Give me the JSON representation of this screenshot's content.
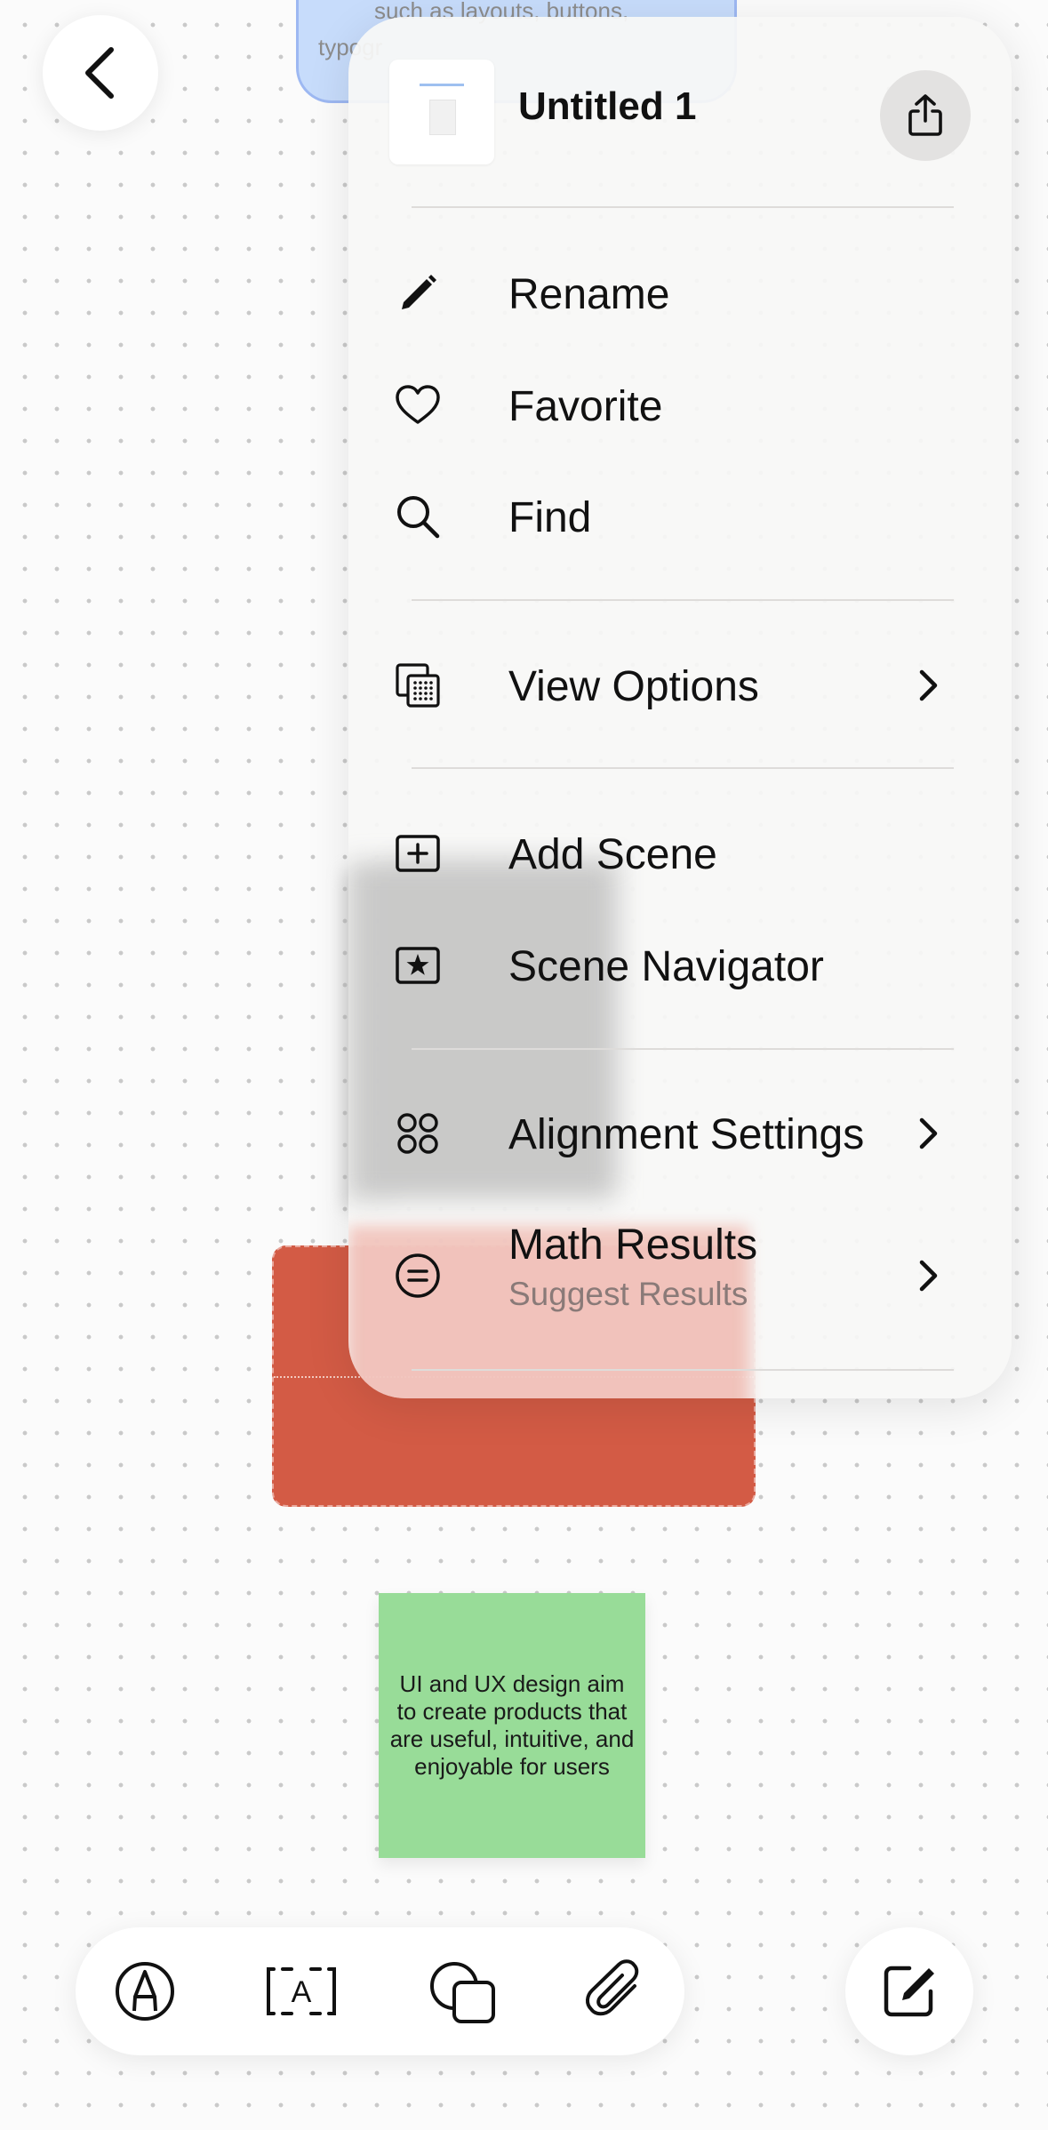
{
  "canvas": {
    "blue_note": {
      "line1": "such as layouts, buttons,",
      "line2": "typogr"
    },
    "green_note": {
      "text": "UI and UX design aim to create products that are useful, intuitive, and enjoyable for users"
    },
    "colors": {
      "blue_note": "#c7dcfb",
      "red_rect": "#d35b45",
      "green_note": "#98dc98"
    }
  },
  "header": {
    "back_icon": "chevron-left-icon"
  },
  "menu": {
    "title": "Untitled 1",
    "share_icon": "share-icon",
    "items": [
      {
        "label": "Rename",
        "icon": "pencil-icon"
      },
      {
        "label": "Favorite",
        "icon": "heart-icon"
      },
      {
        "label": "Find",
        "icon": "magnifier-icon"
      },
      {
        "label": "View Options",
        "icon": "view-options-icon",
        "has_submenu": true
      },
      {
        "label": "Add Scene",
        "icon": "add-scene-icon"
      },
      {
        "label": "Scene Navigator",
        "icon": "scene-navigator-icon"
      },
      {
        "label": "Alignment Settings",
        "icon": "alignment-icon",
        "has_submenu": true
      },
      {
        "label": "Math Results",
        "sublabel": "Suggest Results",
        "icon": "equals-circle-icon",
        "has_submenu": true
      }
    ]
  },
  "toolbar": {
    "tools": [
      {
        "icon": "pen-tool-icon"
      },
      {
        "icon": "text-box-icon",
        "glyph": "A"
      },
      {
        "icon": "shapes-icon"
      },
      {
        "icon": "paperclip-icon"
      }
    ],
    "compose_icon": "compose-icon"
  }
}
